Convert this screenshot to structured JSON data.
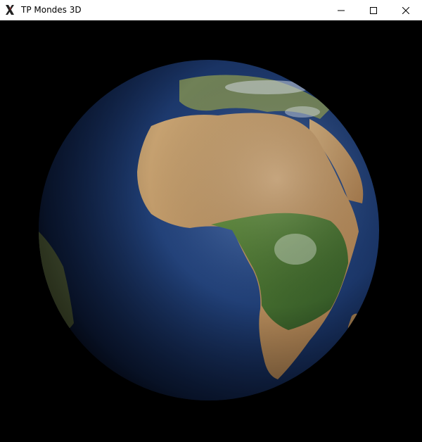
{
  "window": {
    "title": "TP Mondes 3D",
    "app_icon": "x-window-system-icon",
    "controls": {
      "minimize_icon": "minimize-icon",
      "maximize_icon": "maximize-icon",
      "close_icon": "close-icon"
    }
  },
  "scene": {
    "object": "earth-globe",
    "background_color": "#000000",
    "ocean_color": "#1f3d73",
    "land_color": "#b08a5a",
    "vegetation_color": "#3d6b2c"
  }
}
